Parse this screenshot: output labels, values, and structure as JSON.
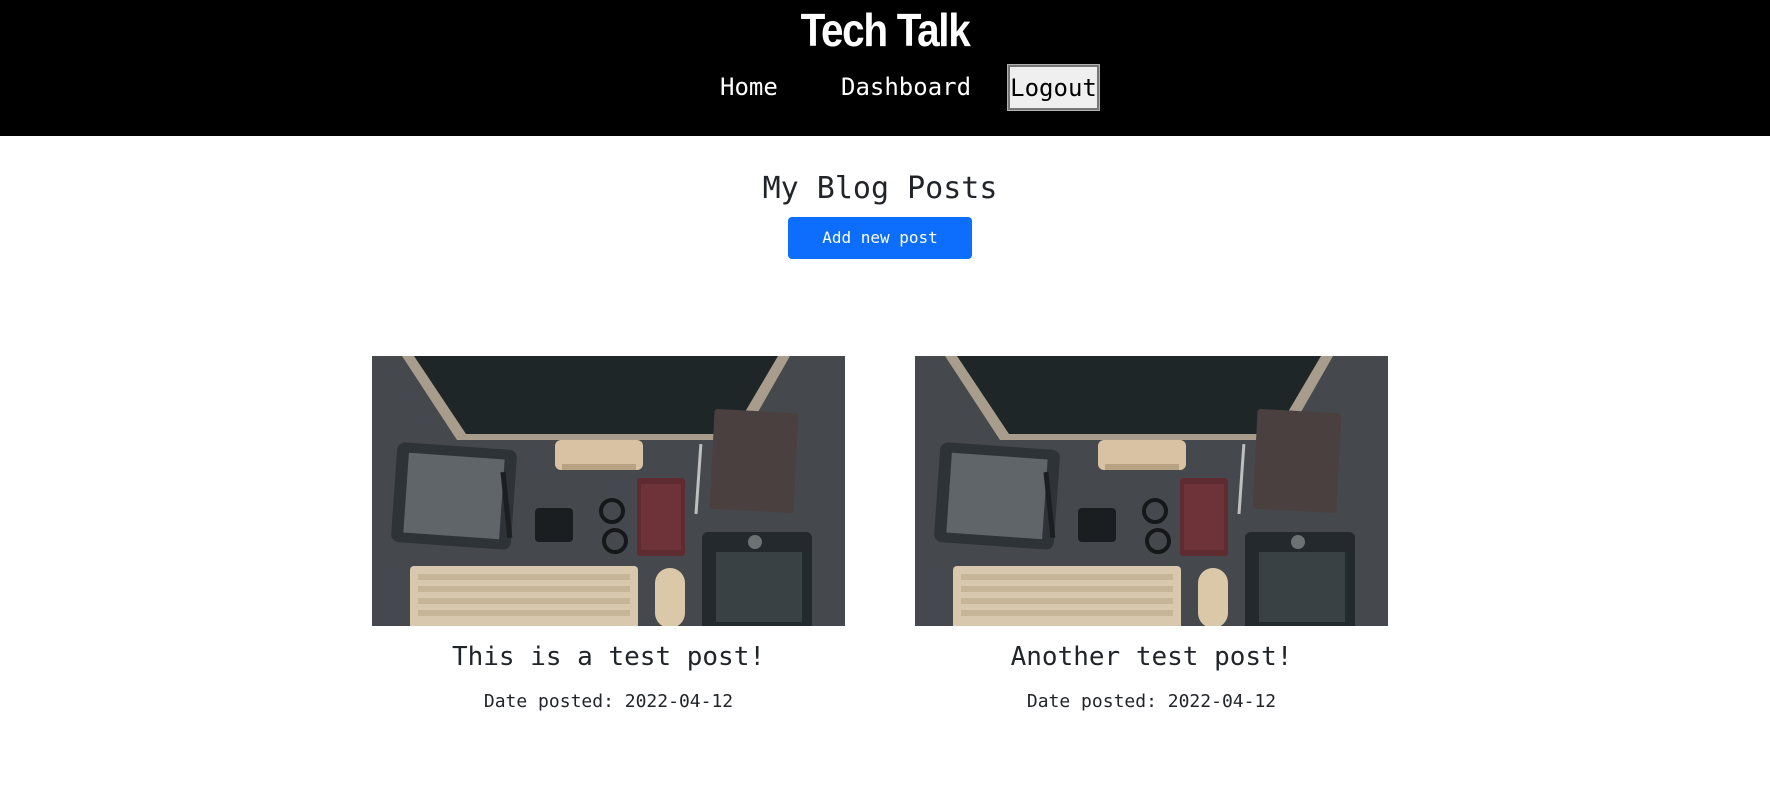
{
  "header": {
    "site_title": "Tech Talk",
    "nav": {
      "home_label": "Home",
      "dashboard_label": "Dashboard",
      "logout_label": "Logout"
    }
  },
  "main": {
    "title": "My Blog Posts",
    "add_button_label": "Add new post",
    "posts": [
      {
        "image_icon": "desk-workspace-photo",
        "title": "This is a test post!",
        "date_text": "Date posted: 2022-04-12"
      },
      {
        "image_icon": "desk-workspace-photo",
        "title": "Another test post!",
        "date_text": "Date posted: 2022-04-12"
      }
    ]
  },
  "colors": {
    "header_bg": "#000000",
    "accent": "#0d6efd",
    "text": "#212529"
  }
}
